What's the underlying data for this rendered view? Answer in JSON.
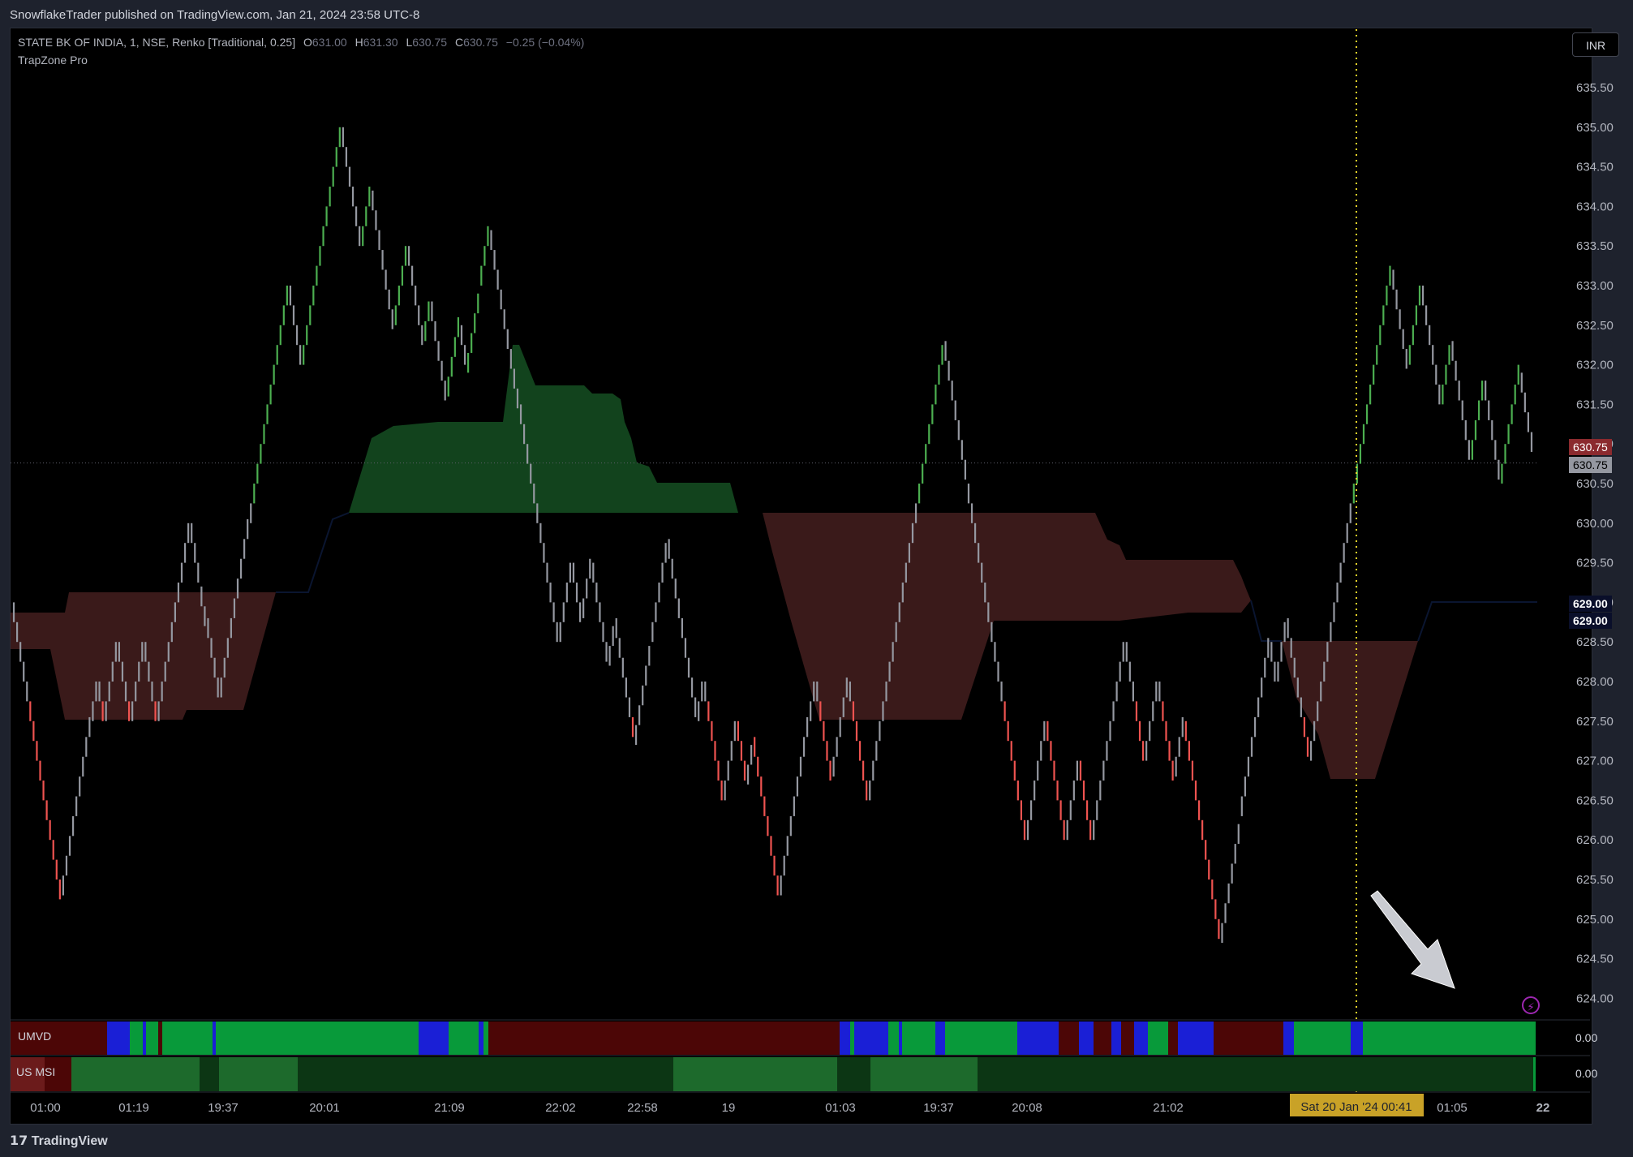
{
  "header": {
    "published": "SnowflakeTrader published on TradingView.com, Jan 21, 2024 23:58 UTC-8"
  },
  "legend": {
    "symbol": "STATE BK OF INDIA, 1, NSE, Renko [Traditional, 0.25]",
    "o_label": "O",
    "o": "631.00",
    "h_label": "H",
    "h": "631.30",
    "l_label": "L",
    "l": "630.75",
    "c_label": "C",
    "c": "630.75",
    "change": "−0.25 (−0.04%)",
    "indicator": "TrapZone Pro"
  },
  "currency_button": "INR",
  "price_tags": {
    "last_red": "630.75",
    "last_gray": "630.75",
    "zone_a": "629.00",
    "zone_b": "629.00"
  },
  "panes": {
    "umvd": {
      "label": "UMVD",
      "value": "0.00"
    },
    "us_msi": {
      "label": "US MSI",
      "value": "0.00"
    }
  },
  "crosshair_time_label": "Sat 20 Jan '24   00:41",
  "footer": {
    "brand": "TradingView"
  },
  "colors": {
    "up": "#4caf50",
    "down": "#ef5350",
    "neutral": "#9598a1",
    "green_zone": "#12431d",
    "red_zone": "#3a1a1a",
    "umvd_green": "#089a3a",
    "umvd_blue": "#1a1fd6",
    "umvd_red": "#4c0606",
    "msi_green": "#1d6a2c",
    "msi_dark": "#0c3614",
    "msi_red": "#6b1b1b",
    "crosshair": "#e8d32a"
  },
  "chart_data": {
    "type": "renko",
    "brick_size": 0.25,
    "y_ticks": [
      "635.50",
      "635.00",
      "634.50",
      "634.00",
      "633.50",
      "633.00",
      "632.50",
      "632.00",
      "631.50",
      "631.00",
      "630.50",
      "630.00",
      "629.50",
      "629.00",
      "628.50",
      "628.00",
      "627.50",
      "627.00",
      "626.50",
      "626.00",
      "625.50",
      "625.00",
      "624.50",
      "624.00"
    ],
    "ylim": [
      623.7,
      636.1
    ],
    "x_ticks": [
      "01:00",
      "01:19",
      "19:37",
      "20:01",
      "21:09",
      "22:02",
      "22:58",
      "19",
      "01:03",
      "19:37",
      "20:08",
      "21:02",
      "",
      "01:05",
      "22"
    ],
    "last_price": 630.75,
    "path_pivots": [
      629.0,
      627.0,
      625.3,
      627.5,
      628.0,
      627.5,
      628.5,
      627.5,
      628.5,
      627.5,
      629.0,
      630.0,
      629.2,
      628.8,
      627.8,
      630.0,
      633.0,
      632.0,
      635.0,
      633.5,
      634.2,
      632.5,
      633.5,
      632.3,
      632.8,
      631.6,
      632.5,
      631.9,
      633.0,
      633.7,
      631.5,
      630.0,
      628.5,
      629.5,
      628.8,
      629.5,
      628.2,
      628.8,
      627.2,
      628.5,
      629.0,
      629.8,
      627.5,
      628.0,
      626.5,
      627.5,
      626.7,
      627.3,
      625.3,
      627.5,
      628.0,
      626.8,
      628.0,
      626.5,
      627.5,
      628.5,
      632.3,
      630.5,
      627.5,
      626.0,
      627.5,
      626.0,
      627.0,
      626.0,
      628.5,
      627.0,
      628.0,
      626.8,
      627.5,
      626.0,
      624.7,
      626.3,
      628.5,
      628.0,
      628.8,
      627.0,
      628.0,
      633.2,
      632.0,
      633.0,
      631.5,
      632.3,
      630.8,
      631.8,
      630.5,
      631.9,
      630.9
    ]
  }
}
